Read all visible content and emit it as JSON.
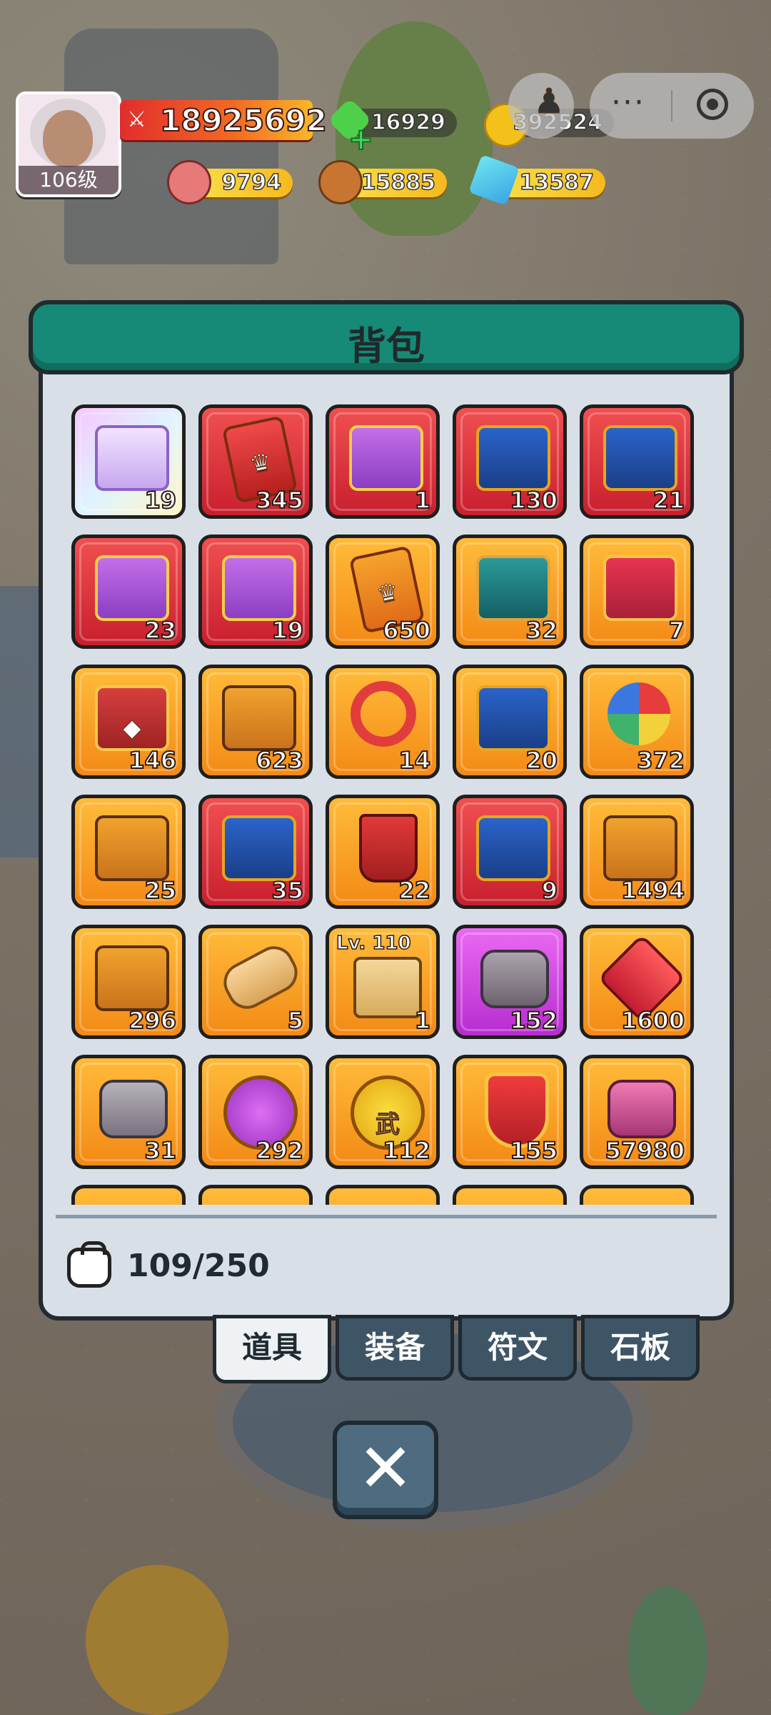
{
  "hud": {
    "level": "106级",
    "power": "18925692",
    "green_gem": "16929",
    "gold": "392524",
    "meat": "9794",
    "wood": "15885",
    "crystal": "13587"
  },
  "bag": {
    "title": "背包",
    "capacity": "109/250",
    "items": [
      {
        "bg": "rainbow",
        "art": "art-chest-purple",
        "glyph": "",
        "count": "19",
        "name": "slot-purple-crown-chest"
      },
      {
        "bg": "red",
        "art": "art-card red",
        "glyph": "♛",
        "count": "345",
        "name": "slot-red-crown-card"
      },
      {
        "bg": "red",
        "art": "art-chest-winged",
        "glyph": "",
        "count": "1",
        "name": "slot-winged-chest"
      },
      {
        "bg": "red",
        "art": "art-chest-blue",
        "glyph": "",
        "count": "130",
        "name": "slot-blue-chest"
      },
      {
        "bg": "red",
        "art": "art-chest-blue",
        "glyph": "",
        "count": "21",
        "name": "slot-blue-chest"
      },
      {
        "bg": "red",
        "art": "art-chest-winged",
        "glyph": "",
        "count": "23",
        "name": "slot-winged-chest"
      },
      {
        "bg": "red",
        "art": "art-chest-winged",
        "glyph": "",
        "count": "19",
        "name": "slot-winged-chest"
      },
      {
        "bg": "orange",
        "art": "art-card",
        "glyph": "♛",
        "count": "650",
        "name": "slot-orange-crown-card"
      },
      {
        "bg": "orange",
        "art": "art-chest-teal",
        "glyph": "",
        "count": "32",
        "name": "slot-teal-chest"
      },
      {
        "bg": "orange",
        "art": "art-chest-fire",
        "glyph": "",
        "count": "7",
        "name": "slot-fire-chest"
      },
      {
        "bg": "orange",
        "art": "art-chest-red",
        "glyph": "◆",
        "count": "146",
        "name": "slot-red-gem-chest"
      },
      {
        "bg": "orange",
        "art": "art-chest",
        "glyph": "",
        "count": "623",
        "name": "slot-gold-chest"
      },
      {
        "bg": "orange",
        "art": "art-ring",
        "glyph": "",
        "count": "14",
        "name": "slot-ring-item"
      },
      {
        "bg": "orange",
        "art": "art-chest-blue",
        "glyph": "",
        "count": "20",
        "name": "slot-blue-crown-chest"
      },
      {
        "bg": "orange",
        "art": "art-pinwheel",
        "glyph": "",
        "count": "372",
        "name": "slot-pinwheel"
      },
      {
        "bg": "orange",
        "art": "art-chest",
        "glyph": "",
        "count": "25",
        "name": "slot-gold-chest"
      },
      {
        "bg": "red",
        "art": "art-chest-blue",
        "glyph": "",
        "count": "35",
        "name": "slot-blue-chest"
      },
      {
        "bg": "orange",
        "art": "art-cup",
        "glyph": "",
        "count": "22",
        "name": "slot-red-cup"
      },
      {
        "bg": "red",
        "art": "art-chest-blue",
        "glyph": "",
        "count": "9",
        "name": "slot-blue-chest"
      },
      {
        "bg": "orange",
        "art": "art-chest",
        "glyph": "",
        "count": "1494",
        "name": "slot-gold-chest"
      },
      {
        "bg": "orange",
        "art": "art-chest",
        "glyph": "",
        "count": "296",
        "name": "slot-gold-chest"
      },
      {
        "bg": "orange",
        "art": "art-scroll",
        "glyph": "",
        "count": "5",
        "name": "slot-scroll"
      },
      {
        "bg": "orange",
        "art": "art-map",
        "glyph": "",
        "count": "1",
        "lv": "Lv. 110",
        "name": "slot-level-map"
      },
      {
        "bg": "purple",
        "art": "art-rock purple",
        "glyph": "",
        "count": "152",
        "name": "slot-purple-stones"
      },
      {
        "bg": "orange",
        "art": "art-gem-red",
        "glyph": "",
        "count": "1600",
        "name": "slot-red-gem"
      },
      {
        "bg": "orange",
        "art": "art-rock",
        "glyph": "",
        "count": "31",
        "name": "slot-stone-tablet"
      },
      {
        "bg": "orange",
        "art": "art-coin purple",
        "glyph": "",
        "count": "292",
        "name": "slot-purple-coin"
      },
      {
        "bg": "orange",
        "art": "art-coin",
        "glyph": "武",
        "count": "112",
        "name": "slot-wu-coin"
      },
      {
        "bg": "orange",
        "art": "art-shield",
        "glyph": "",
        "count": "155",
        "name": "slot-sword-shield"
      },
      {
        "bg": "orange",
        "art": "art-rock pink",
        "glyph": "",
        "count": "57980",
        "name": "slot-pink-ore"
      }
    ]
  },
  "tabs": [
    "道具",
    "装备",
    "符文",
    "石板"
  ],
  "icons": {
    "power": "crossed-swords-icon",
    "close": "close-icon",
    "bag": "bag-icon",
    "more": "more-icon",
    "target": "target-icon"
  }
}
